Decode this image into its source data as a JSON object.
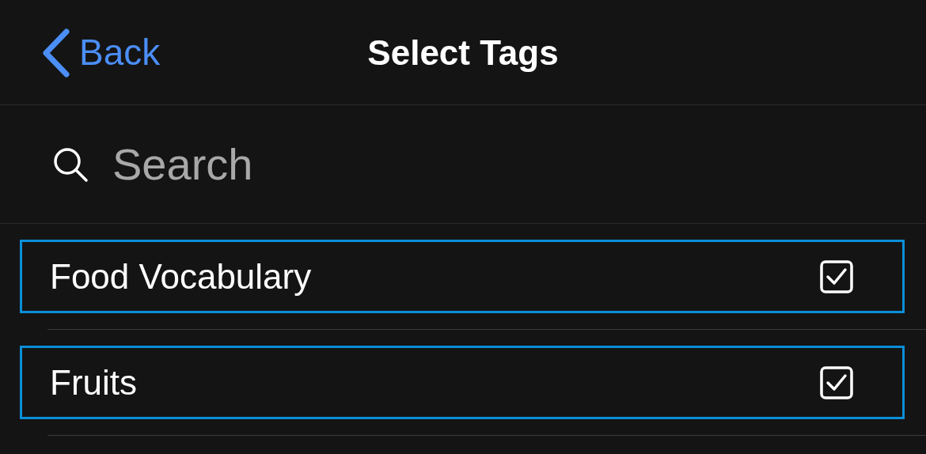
{
  "nav": {
    "back": "Back",
    "title": "Select Tags"
  },
  "search": {
    "placeholder": "Search"
  },
  "tags": [
    {
      "label": "Food Vocabulary",
      "checked": true,
      "highlighted": true
    },
    {
      "label": "Fruits",
      "checked": true,
      "highlighted": true
    }
  ]
}
